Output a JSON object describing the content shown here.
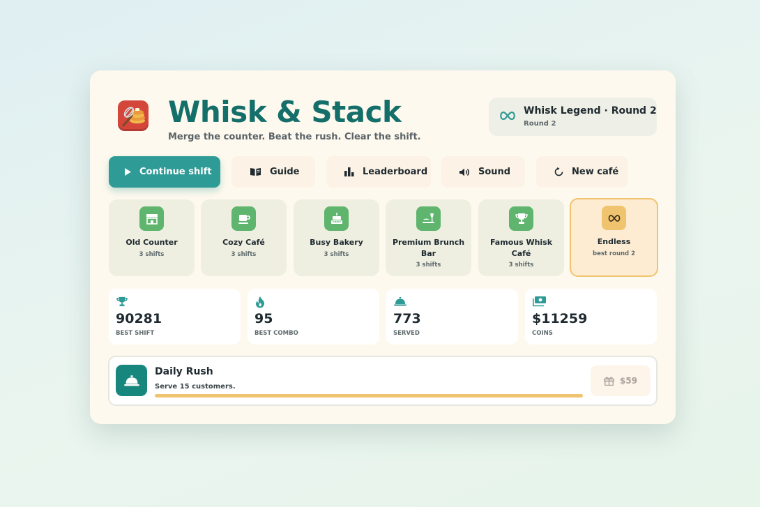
{
  "header": {
    "title": "Whisk & Stack",
    "subtitle": "Merge the counter. Beat the rush. Clear the shift."
  },
  "rank": {
    "title": "Whisk Legend · Round 2",
    "subtitle": "Round 2",
    "icon": "infinity-icon"
  },
  "buttons": [
    {
      "label": "Continue shift",
      "icon": "play-icon"
    },
    {
      "label": "Guide",
      "icon": "book-icon"
    },
    {
      "label": "Leaderboard",
      "icon": "bar-chart-icon"
    },
    {
      "label": "Sound",
      "icon": "speaker-icon"
    },
    {
      "label": "New café",
      "icon": "restart-icon"
    }
  ],
  "levels": [
    {
      "name": "Old Counter",
      "sub": "3 shifts",
      "icon": "storefront-icon"
    },
    {
      "name": "Cozy Café",
      "sub": "3 shifts",
      "icon": "coffee-cup-icon"
    },
    {
      "name": "Busy Bakery",
      "sub": "3 shifts",
      "icon": "cake-icon"
    },
    {
      "name": "Premium Brunch Bar",
      "sub": "3 shifts",
      "icon": "brunch-icon"
    },
    {
      "name": "Famous Whisk Café",
      "sub": "3 shifts",
      "icon": "trophy-icon"
    },
    {
      "name": "Endless",
      "sub": "best round 2",
      "icon": "infinity-icon",
      "selected": true
    }
  ],
  "stats": [
    {
      "value": "90281",
      "label": "BEST SHIFT",
      "icon": "trophy-icon"
    },
    {
      "value": "95",
      "label": "BEST COMBO",
      "icon": "flame-icon"
    },
    {
      "value": "773",
      "label": "SERVED",
      "icon": "cloche-icon"
    },
    {
      "value": "$11259",
      "label": "COINS",
      "icon": "cash-icon"
    }
  ],
  "daily": {
    "title": "Daily Rush",
    "desc": "Serve 15 customers.",
    "progress_percent": 100,
    "reward": "$59",
    "icon": "cloche-icon",
    "reward_icon": "gift-icon"
  },
  "colors": {
    "brand": "#146f6a",
    "primary_button": "#2f9b96",
    "level_badge": "#5fb56e",
    "selected": "#f0c36e",
    "accent_icon": "#2f9b96"
  }
}
